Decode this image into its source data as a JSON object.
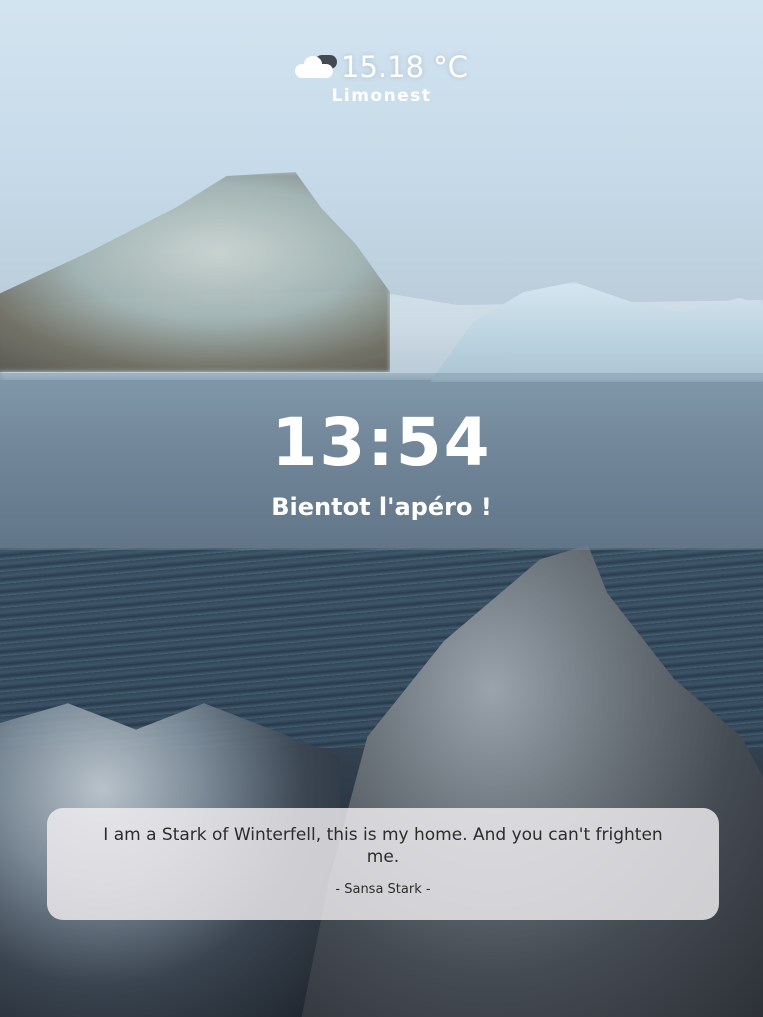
{
  "weather": {
    "icon": "partly-cloudy-icon",
    "temperature": "15.18 °C",
    "city": "Limonest"
  },
  "clock": {
    "time": "13:54",
    "message": "Bientot l'apéro !"
  },
  "quote": {
    "text": "I am a Stark of Winterfell, this is my home. And you can't frighten me.",
    "author": "- Sansa Stark -"
  },
  "colors": {
    "text": "#ffffff",
    "quote_text": "#2c2c2c",
    "clock_band": "#788ca0"
  }
}
